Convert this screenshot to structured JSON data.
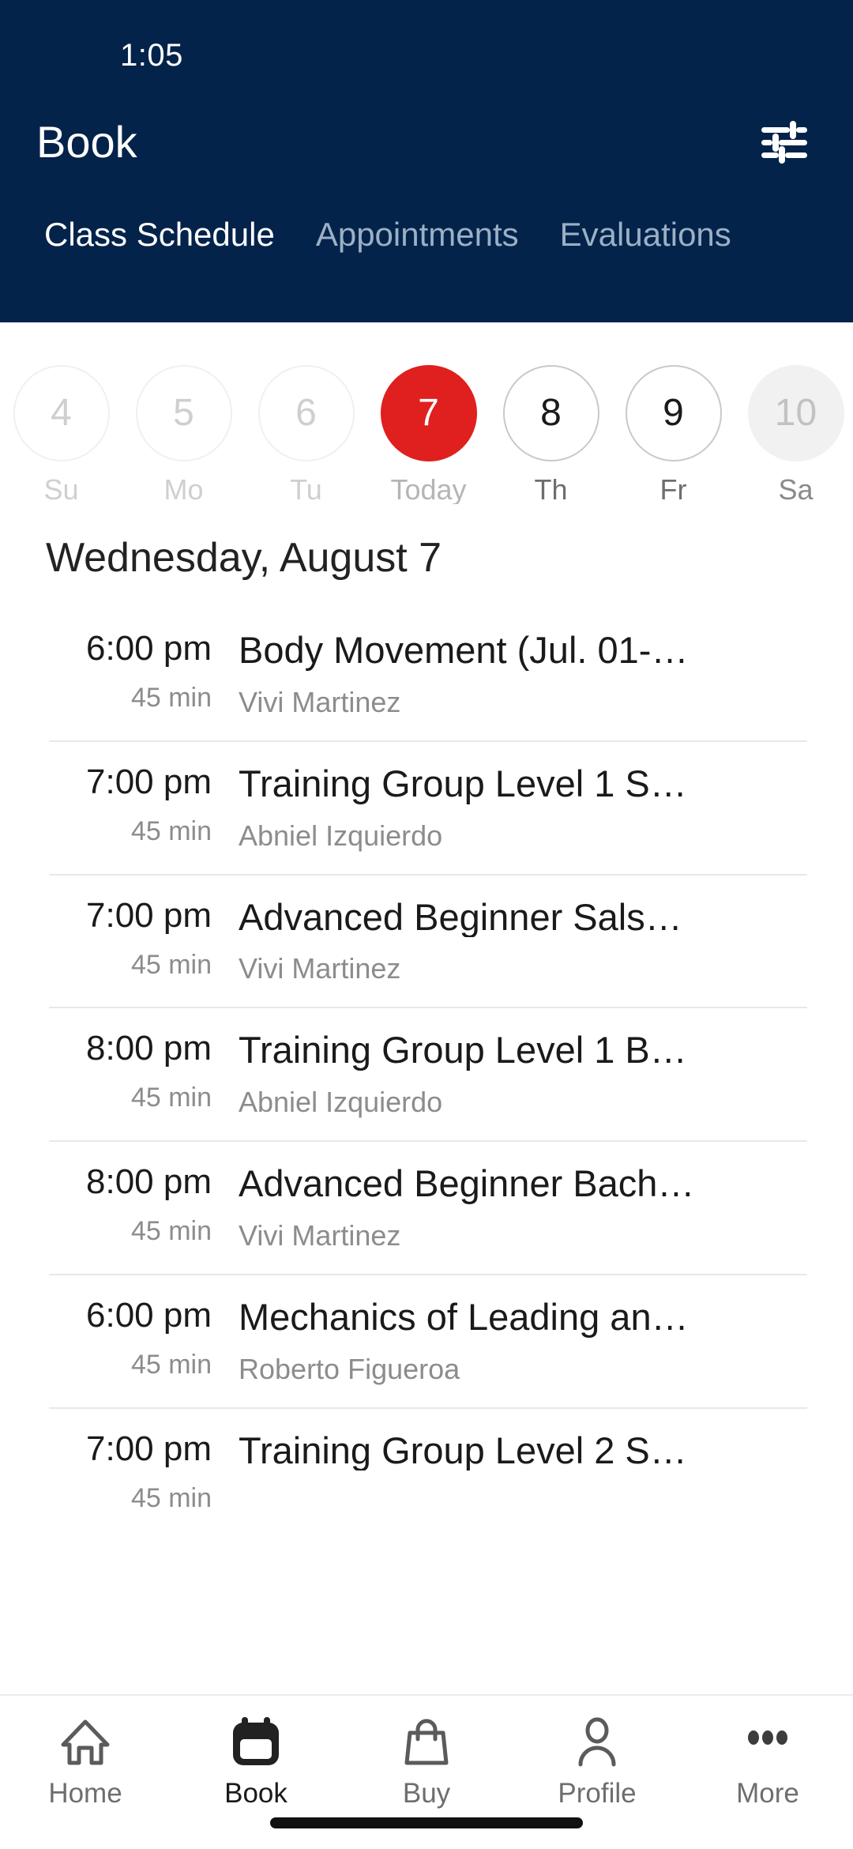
{
  "status_bar": {
    "time": "1:05"
  },
  "header": {
    "title": "Book",
    "filter_icon": "sliders-filter-icon",
    "background_color": "#04234a",
    "tabs": [
      {
        "label": "Class Schedule",
        "active": true
      },
      {
        "label": "Appointments",
        "active": false
      },
      {
        "label": "Evaluations",
        "active": false
      }
    ]
  },
  "date_strip": {
    "accent_color": "#e01f1f",
    "days": [
      {
        "number": "4",
        "label": "Su",
        "state": "disabled"
      },
      {
        "number": "5",
        "label": "Mo",
        "state": "disabled"
      },
      {
        "number": "6",
        "label": "Tu",
        "state": "disabled"
      },
      {
        "number": "7",
        "label": "Today",
        "state": "today"
      },
      {
        "number": "8",
        "label": "Th",
        "state": "normal"
      },
      {
        "number": "9",
        "label": "Fr",
        "state": "normal"
      },
      {
        "number": "10",
        "label": "Sa",
        "state": "muted"
      }
    ]
  },
  "schedule": {
    "date_heading": "Wednesday, August 7",
    "classes": [
      {
        "time": "6:00 pm",
        "duration": "45 min",
        "name": "Body Movement (Jul. 01-…",
        "instructor": "Vivi Martinez"
      },
      {
        "time": "7:00 pm",
        "duration": "45 min",
        "name": "Training Group Level 1 S…",
        "instructor": "Abniel Izquierdo"
      },
      {
        "time": "7:00 pm",
        "duration": "45 min",
        "name": "Advanced Beginner Sals…",
        "instructor": "Vivi Martinez"
      },
      {
        "time": "8:00 pm",
        "duration": "45 min",
        "name": "Training Group Level 1 B…",
        "instructor": "Abniel Izquierdo"
      },
      {
        "time": "8:00 pm",
        "duration": "45 min",
        "name": "Advanced Beginner Bach…",
        "instructor": "Vivi Martinez"
      },
      {
        "time": "6:00 pm",
        "duration": "45 min",
        "name": "Mechanics of Leading an…",
        "instructor": "Roberto Figueroa"
      },
      {
        "time": "7:00 pm",
        "duration": "45 min",
        "name": "Training Group Level 2 S…",
        "instructor": ""
      }
    ]
  },
  "bottom_nav": {
    "items": [
      {
        "label": "Home",
        "icon": "home-icon",
        "active": false
      },
      {
        "label": "Book",
        "icon": "calendar-icon",
        "active": true
      },
      {
        "label": "Buy",
        "icon": "bag-icon",
        "active": false
      },
      {
        "label": "Profile",
        "icon": "person-icon",
        "active": false
      },
      {
        "label": "More",
        "icon": "ellipsis-icon",
        "active": false
      }
    ]
  }
}
